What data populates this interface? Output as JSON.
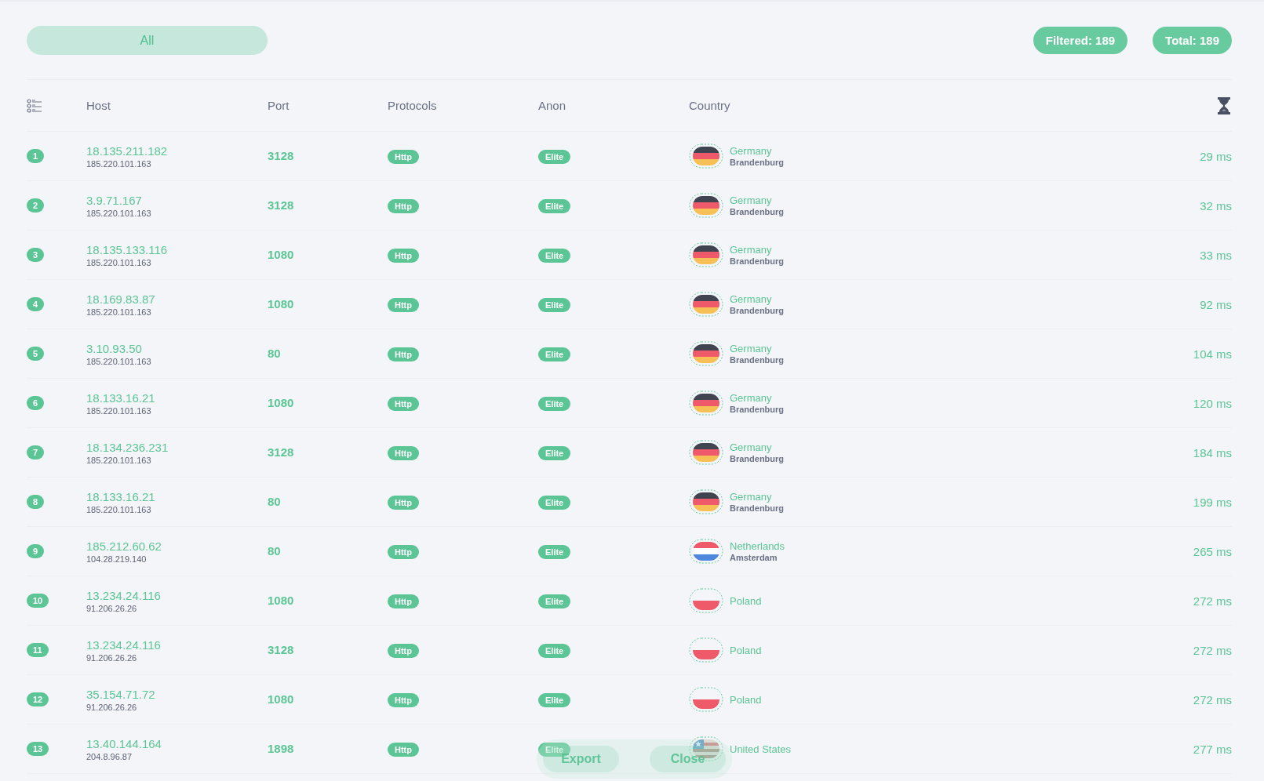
{
  "filter": {
    "label": "All",
    "selected": true
  },
  "counters": [
    "Filtered: 189",
    "Total: 189"
  ],
  "table": {
    "columns": [
      "Host",
      "Port",
      "Protocols",
      "Anon",
      "Country"
    ],
    "rows": [
      {
        "index": "1",
        "host": "18.135.211.182",
        "ip": "185.220.101.163",
        "port": "3128",
        "protocol": "Http",
        "anon": "Elite",
        "kind": "de",
        "country": "Germany",
        "region": "Brandenburg",
        "latency": "29 ms"
      },
      {
        "index": "2",
        "host": "3.9.71.167",
        "ip": "185.220.101.163",
        "port": "3128",
        "protocol": "Http",
        "anon": "Elite",
        "kind": "de",
        "country": "Germany",
        "region": "Brandenburg",
        "latency": "32 ms"
      },
      {
        "index": "3",
        "host": "18.135.133.116",
        "ip": "185.220.101.163",
        "port": "1080",
        "protocol": "Http",
        "anon": "Elite",
        "kind": "de",
        "country": "Germany",
        "region": "Brandenburg",
        "latency": "33 ms"
      },
      {
        "index": "4",
        "host": "18.169.83.87",
        "ip": "185.220.101.163",
        "port": "1080",
        "protocol": "Http",
        "anon": "Elite",
        "kind": "de",
        "country": "Germany",
        "region": "Brandenburg",
        "latency": "92 ms"
      },
      {
        "index": "5",
        "host": "3.10.93.50",
        "ip": "185.220.101.163",
        "port": "80",
        "protocol": "Http",
        "anon": "Elite",
        "kind": "de",
        "country": "Germany",
        "region": "Brandenburg",
        "latency": "104 ms"
      },
      {
        "index": "6",
        "host": "18.133.16.21",
        "ip": "185.220.101.163",
        "port": "1080",
        "protocol": "Http",
        "anon": "Elite",
        "kind": "de",
        "country": "Germany",
        "region": "Brandenburg",
        "latency": "120 ms"
      },
      {
        "index": "7",
        "host": "18.134.236.231",
        "ip": "185.220.101.163",
        "port": "3128",
        "protocol": "Http",
        "anon": "Elite",
        "kind": "de",
        "country": "Germany",
        "region": "Brandenburg",
        "latency": "184 ms"
      },
      {
        "index": "8",
        "host": "18.133.16.21",
        "ip": "185.220.101.163",
        "port": "80",
        "protocol": "Http",
        "anon": "Elite",
        "kind": "de",
        "country": "Germany",
        "region": "Brandenburg",
        "latency": "199 ms"
      },
      {
        "index": "9",
        "host": "185.212.60.62",
        "ip": "104.28.219.140",
        "port": "80",
        "protocol": "Http",
        "anon": "Elite",
        "kind": "nl",
        "country": "Netherlands",
        "region": "Amsterdam",
        "latency": "265 ms"
      },
      {
        "index": "10",
        "host": "13.234.24.116",
        "ip": "91.206.26.26",
        "port": "1080",
        "protocol": "Http",
        "anon": "Elite",
        "kind": "pl",
        "country": "Poland",
        "latency": "272 ms"
      },
      {
        "index": "11",
        "host": "13.234.24.116",
        "ip": "91.206.26.26",
        "port": "3128",
        "protocol": "Http",
        "anon": "Elite",
        "kind": "pl",
        "country": "Poland",
        "latency": "272 ms"
      },
      {
        "index": "12",
        "host": "35.154.71.72",
        "ip": "91.206.26.26",
        "port": "1080",
        "protocol": "Http",
        "anon": "Elite",
        "kind": "pl",
        "country": "Poland",
        "latency": "272 ms"
      },
      {
        "index": "13",
        "host": "13.40.144.164",
        "ip": "204.8.96.87",
        "port": "1898",
        "protocol": "Http",
        "anon": "Elite",
        "kind": "us",
        "country": "United States",
        "latency": "277 ms"
      }
    ]
  },
  "actions": [
    "Export",
    "Close"
  ]
}
